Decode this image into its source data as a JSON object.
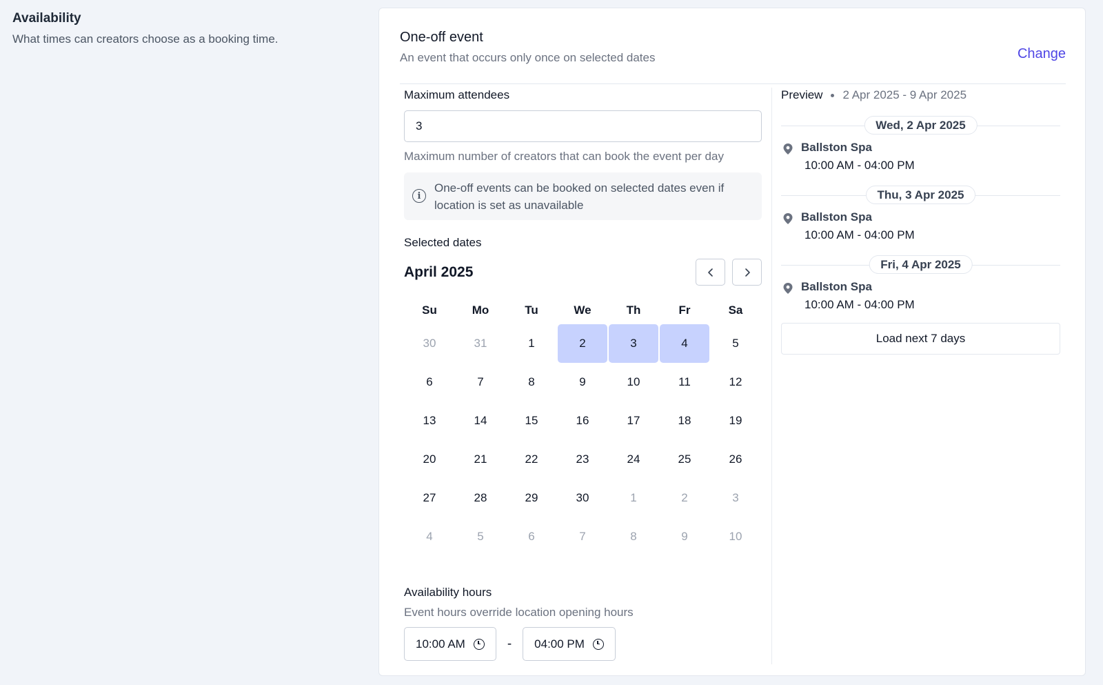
{
  "section": {
    "title": "Availability",
    "description": "What times can creators choose as a booking time."
  },
  "event": {
    "type": "One-off event",
    "description": "An event that occurs only once on selected dates",
    "change_label": "Change"
  },
  "attendees": {
    "label": "Maximum attendees",
    "value": "3",
    "help": "Maximum number of creators that can book the event per day"
  },
  "info": {
    "icon": "info-icon",
    "text": "One-off events can be booked on selected dates even if location is set as unavailable"
  },
  "calendar": {
    "label": "Selected dates",
    "month": "April 2025",
    "weekdays": [
      "Su",
      "Mo",
      "Tu",
      "We",
      "Th",
      "Fr",
      "Sa"
    ],
    "days": [
      {
        "d": "30",
        "muted": true
      },
      {
        "d": "31",
        "muted": true
      },
      {
        "d": "1"
      },
      {
        "d": "2",
        "selected": true
      },
      {
        "d": "3",
        "selected": true
      },
      {
        "d": "4",
        "selected": true
      },
      {
        "d": "5"
      },
      {
        "d": "6"
      },
      {
        "d": "7"
      },
      {
        "d": "8"
      },
      {
        "d": "9"
      },
      {
        "d": "10"
      },
      {
        "d": "11"
      },
      {
        "d": "12"
      },
      {
        "d": "13"
      },
      {
        "d": "14"
      },
      {
        "d": "15"
      },
      {
        "d": "16"
      },
      {
        "d": "17"
      },
      {
        "d": "18"
      },
      {
        "d": "19"
      },
      {
        "d": "20"
      },
      {
        "d": "21"
      },
      {
        "d": "22"
      },
      {
        "d": "23"
      },
      {
        "d": "24"
      },
      {
        "d": "25"
      },
      {
        "d": "26"
      },
      {
        "d": "27"
      },
      {
        "d": "28"
      },
      {
        "d": "29"
      },
      {
        "d": "30"
      },
      {
        "d": "1",
        "muted": true
      },
      {
        "d": "2",
        "muted": true
      },
      {
        "d": "3",
        "muted": true
      },
      {
        "d": "4",
        "muted": true
      },
      {
        "d": "5",
        "muted": true
      },
      {
        "d": "6",
        "muted": true
      },
      {
        "d": "7",
        "muted": true
      },
      {
        "d": "8",
        "muted": true
      },
      {
        "d": "9",
        "muted": true
      },
      {
        "d": "10",
        "muted": true
      }
    ]
  },
  "hours": {
    "label": "Availability hours",
    "description": "Event hours override location opening hours",
    "start": "10:00 AM",
    "separator": "-",
    "end": "04:00 PM"
  },
  "preview": {
    "label": "Preview",
    "range": "2 Apr 2025 - 9 Apr 2025",
    "days": [
      {
        "date": "Wed, 2 Apr 2025",
        "location": "Ballston Spa",
        "time": "10:00 AM - 04:00 PM"
      },
      {
        "date": "Thu, 3 Apr 2025",
        "location": "Ballston Spa",
        "time": "10:00 AM - 04:00 PM"
      },
      {
        "date": "Fri, 4 Apr 2025",
        "location": "Ballston Spa",
        "time": "10:00 AM - 04:00 PM"
      }
    ],
    "load_more": "Load next 7 days"
  },
  "colors": {
    "accent": "#4f46e5",
    "selected_day": "#c7d2fe",
    "page_bg": "#f1f4f9"
  }
}
